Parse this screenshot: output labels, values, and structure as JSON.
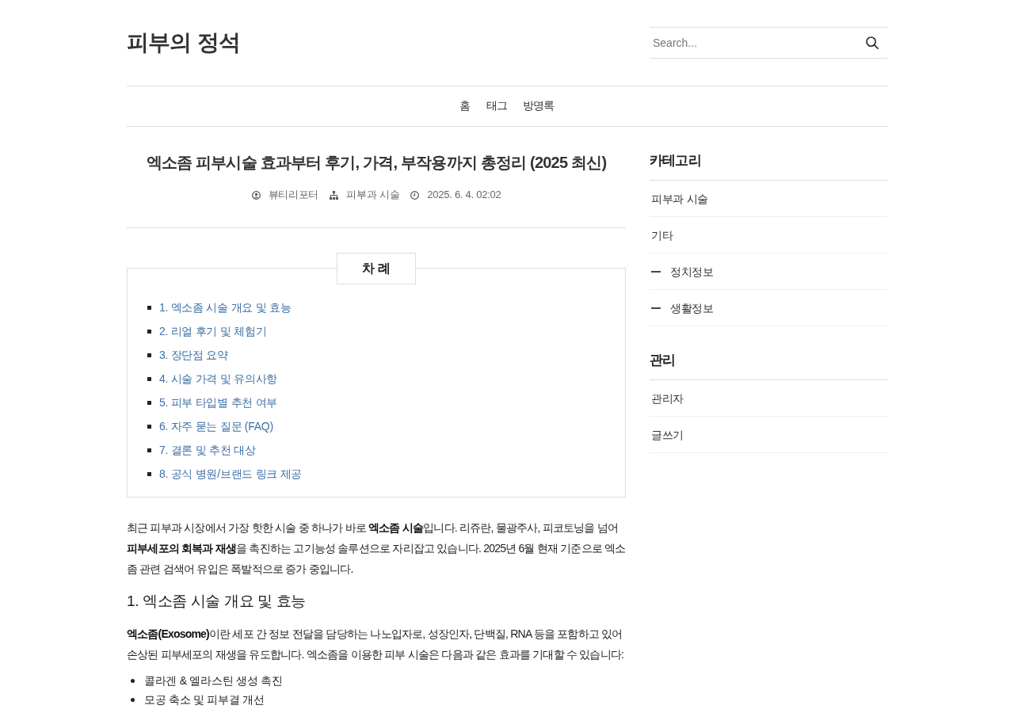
{
  "site": {
    "title": "피부의 정석"
  },
  "search": {
    "placeholder": "Search..."
  },
  "nav": [
    {
      "label": "홈"
    },
    {
      "label": "태그"
    },
    {
      "label": "방명록"
    }
  ],
  "post": {
    "title": "엑소좀 피부시술 효과부터 후기, 가격, 부작용까지 총정리 (2025 최신)",
    "meta": {
      "author": "뷰티리포터",
      "category": "피부과 시술",
      "date": "2025. 6. 4. 02:02"
    },
    "toc": {
      "title": "차 례",
      "items": [
        "1. 엑소좀 시술 개요 및 효능",
        "2. 리얼 후기 및 체험기",
        "3. 장단점 요약",
        "4. 시술 가격 및 유의사항",
        "5. 피부 타입별 추천 여부",
        "6. 자주 묻는 질문 (FAQ)",
        "7. 결론 및 추천 대상",
        "8. 공식 병원/브랜드 링크 제공"
      ]
    },
    "body": [
      {
        "kind": "paragraph",
        "text": "최근 피부과 시장에서 가장 핫한 시술 중 하나가 바로 **엑소좀 시술**입니다. 리쥬란, 물광주사, 피코토닝을 넘어 **피부세포의 회복과 재생**을 촉진하는 고기능성 솔루션으로 자리잡고 있습니다. 2025년 6월 현재 기준으로 엑소좀 관련 검색어 유입은 폭발적으로 증가 중입니다."
      },
      {
        "kind": "heading",
        "text": "1. 엑소좀 시술 개요 및 효능"
      },
      {
        "kind": "paragraph",
        "text": "**엑소좀(Exosome)**이란 세포 간 정보 전달을 담당하는 나노입자로, 성장인자, 단백질, RNA 등을 포함하고 있어 손상된 피부세포의 재생을 유도합니다. 엑소좀을 이용한 피부 시술은 다음과 같은 효과를 기대할 수 있습니다:"
      },
      {
        "kind": "list",
        "items": [
          "콜라겐 & 엘라스틴 생성 촉진",
          "모공 축소 및 피부결 개선"
        ]
      }
    ]
  },
  "sidebar": {
    "sections": [
      {
        "title": "카테고리",
        "items": [
          {
            "label": "피부과 시술"
          },
          {
            "label": "기타",
            "children": [
              {
                "label": "정치정보"
              },
              {
                "label": "생활정보"
              }
            ]
          }
        ]
      },
      {
        "title": "관리",
        "items": [
          {
            "label": "관리자"
          },
          {
            "label": "글쓰기"
          }
        ]
      }
    ]
  }
}
